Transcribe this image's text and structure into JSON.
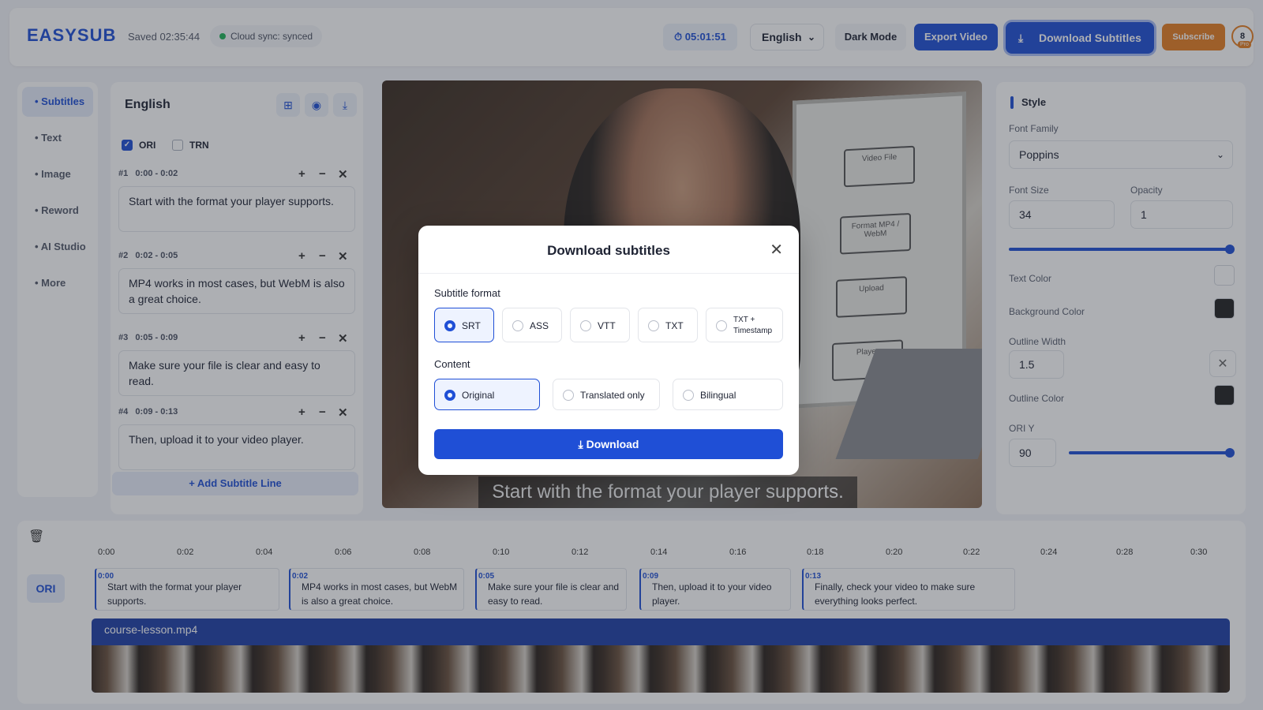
{
  "header": {
    "logo": "EASYSUB",
    "saved": "Saved 02:35:44",
    "cloud_sync": "Cloud sync: synced",
    "timer": "05:01:51",
    "language": "English",
    "dark_mode": "Dark Mode",
    "export_video": "Export Video",
    "download_subtitles": "Download Subtitles",
    "subscribe": "Subscribe",
    "avatar": "8",
    "pro": "Pro"
  },
  "nav": [
    "Subtitles",
    "Text",
    "Image",
    "Reword",
    "AI Studio",
    "More"
  ],
  "subtitles_panel": {
    "language": "English",
    "ori_label": "ORI",
    "trn_label": "TRN",
    "items": [
      {
        "index": "#1",
        "range": "0:00 - 0:02",
        "text": "Start with the format your player supports."
      },
      {
        "index": "#2",
        "range": "0:02 - 0:05",
        "text": "MP4 works in most cases, but WebM is also a great choice."
      },
      {
        "index": "#3",
        "range": "0:05 - 0:09",
        "text": "Make sure your file is clear and easy to read."
      },
      {
        "index": "#4",
        "range": "0:09 - 0:13",
        "text": "Then, upload it to your video player."
      }
    ],
    "add_line": "+ Add Subtitle Line"
  },
  "video": {
    "caption": "Start with the format your player supports.",
    "flowchart": [
      "Video File",
      "Format MP4 / WebM",
      "Upload",
      "Player"
    ]
  },
  "style_panel": {
    "title": "Style",
    "font_family_label": "Font Family",
    "font_family": "Poppins",
    "font_size_label": "Font Size",
    "font_size": "34",
    "opacity_label": "Opacity",
    "opacity": "1",
    "text_color_label": "Text Color",
    "background_color_label": "Background Color",
    "outline_width_label": "Outline Width",
    "outline_width": "1.5",
    "outline_color_label": "Outline Color",
    "ori_y_label": "ORI Y",
    "ori_y": "90",
    "colors": {
      "text": "#ffffff",
      "background": "#222222",
      "outline": "#222222"
    }
  },
  "timeline": {
    "ticks": [
      "0:00",
      "0:02",
      "0:04",
      "0:06",
      "0:08",
      "0:10",
      "0:12",
      "0:14",
      "0:16",
      "0:18",
      "0:20",
      "0:22",
      "0:24",
      "0:28",
      "0:30"
    ],
    "track_label": "ORI",
    "clips": [
      {
        "start": "0:00",
        "text": "Start with the format your player supports."
      },
      {
        "start": "0:02",
        "text": "MP4 works in most cases, but WebM is also a great choice."
      },
      {
        "start": "0:05",
        "text": "Make sure your file is clear and easy to read."
      },
      {
        "start": "0:09",
        "text": "Then, upload it to your video player."
      },
      {
        "start": "0:13",
        "text": "Finally, check your video to make sure everything looks perfect."
      }
    ],
    "video_file": "course-lesson.mp4"
  },
  "modal": {
    "title": "Download subtitles",
    "format_label": "Subtitle format",
    "formats": [
      "SRT",
      "ASS",
      "VTT",
      "TXT",
      "TXT + Timestamp"
    ],
    "selected_format": "SRT",
    "content_label": "Content",
    "content_options": [
      "Original",
      "Translated only",
      "Bilingual"
    ],
    "selected_content": "Original",
    "download": "Download"
  },
  "accent": "#1f4fd6"
}
